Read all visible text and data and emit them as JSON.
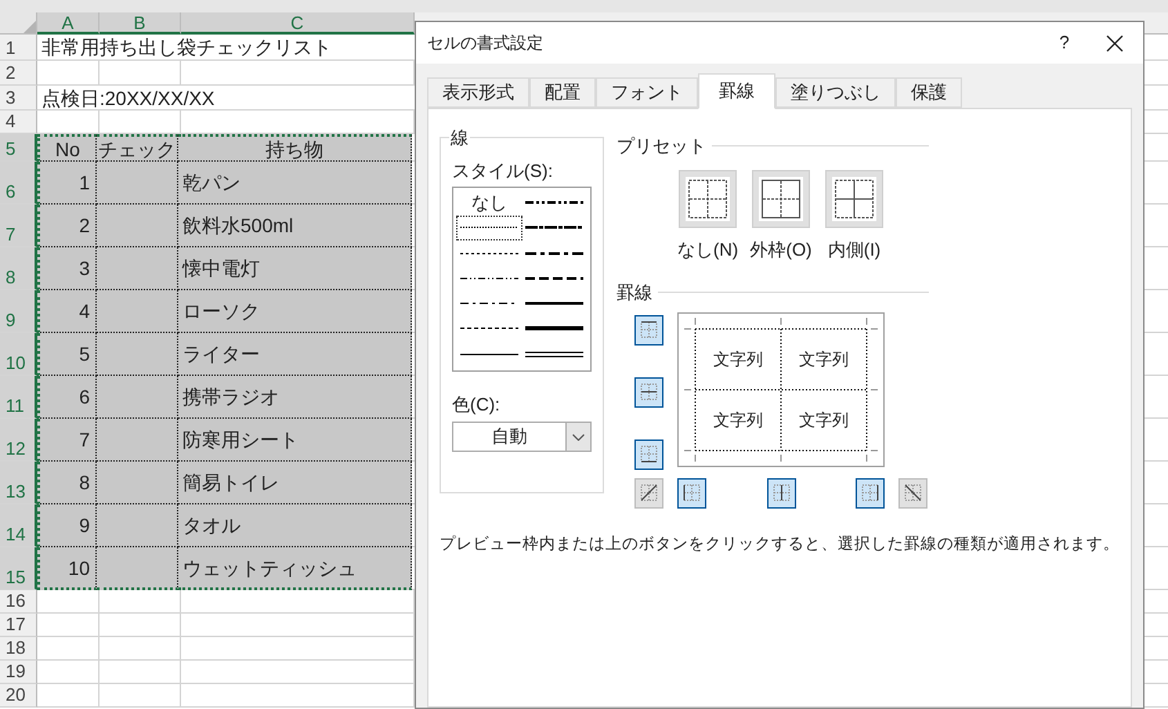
{
  "sheet": {
    "columns": [
      {
        "label": "A",
        "selected": true
      },
      {
        "label": "B",
        "selected": true
      },
      {
        "label": "C",
        "selected": true
      }
    ],
    "rows": [
      {
        "header": "1",
        "kind": "text",
        "text": "非常用持ち出し袋チェックリスト",
        "selected": false
      },
      {
        "header": "2",
        "kind": "blank",
        "selected": false
      },
      {
        "header": "3",
        "kind": "text",
        "text": "点検日:20XX/XX/XX",
        "selected": false
      },
      {
        "header": "4",
        "kind": "blank",
        "selected": false
      },
      {
        "header": "5",
        "kind": "table_header",
        "columns": [
          "No",
          "チェック",
          "持ち物"
        ],
        "selected": true
      },
      {
        "header": "6",
        "kind": "item",
        "no": "1",
        "item": "乾パン",
        "selected": true
      },
      {
        "header": "7",
        "kind": "item",
        "no": "2",
        "item": "飲料水500ml",
        "selected": true
      },
      {
        "header": "8",
        "kind": "item",
        "no": "3",
        "item": "懐中電灯",
        "selected": true
      },
      {
        "header": "9",
        "kind": "item",
        "no": "4",
        "item": "ローソク",
        "selected": true
      },
      {
        "header": "10",
        "kind": "item",
        "no": "5",
        "item": "ライター",
        "selected": true
      },
      {
        "header": "11",
        "kind": "item",
        "no": "6",
        "item": "携帯ラジオ",
        "selected": true
      },
      {
        "header": "12",
        "kind": "item",
        "no": "7",
        "item": "防寒用シート",
        "selected": true
      },
      {
        "header": "13",
        "kind": "item",
        "no": "8",
        "item": "簡易トイレ",
        "selected": true
      },
      {
        "header": "14",
        "kind": "item",
        "no": "9",
        "item": "タオル",
        "selected": true
      },
      {
        "header": "15",
        "kind": "item",
        "no": "10",
        "item": "ウェットティッシュ",
        "selected": true
      },
      {
        "header": "16",
        "kind": "blank",
        "selected": false
      },
      {
        "header": "17",
        "kind": "blank",
        "selected": false
      },
      {
        "header": "18",
        "kind": "blank",
        "selected": false
      },
      {
        "header": "19",
        "kind": "blank",
        "selected": false
      },
      {
        "header": "20",
        "kind": "blank",
        "selected": false
      }
    ]
  },
  "dialog": {
    "title": "セルの書式設定",
    "help": "?",
    "tabs": [
      {
        "label": "表示形式",
        "selected": false
      },
      {
        "label": "配置",
        "selected": false
      },
      {
        "label": "フォント",
        "selected": false
      },
      {
        "label": "罫線",
        "selected": true
      },
      {
        "label": "塗りつぶし",
        "selected": false
      },
      {
        "label": "保護",
        "selected": false
      }
    ],
    "line": {
      "title": "線",
      "style_label": "スタイル(S):",
      "styles": [
        {
          "kind": "none",
          "label": "なし",
          "selected": false
        },
        {
          "kind": "hair",
          "selected": true
        },
        {
          "kind": "dotted",
          "selected": false
        },
        {
          "kind": "dash_dot_dot",
          "selected": false
        },
        {
          "kind": "dash_dot",
          "selected": false
        },
        {
          "kind": "dashed",
          "selected": false
        },
        {
          "kind": "thin",
          "selected": false
        },
        {
          "kind": "medium_dash_dot_dot",
          "selected": false
        },
        {
          "kind": "slant_dash_dot",
          "selected": false
        },
        {
          "kind": "medium_dash_dot",
          "selected": false
        },
        {
          "kind": "medium_dashed",
          "selected": false
        },
        {
          "kind": "medium",
          "selected": false
        },
        {
          "kind": "thick",
          "selected": false
        },
        {
          "kind": "double",
          "selected": false
        }
      ],
      "color_label": "色(C):",
      "color_value": "自動"
    },
    "presets": {
      "title": "プリセット",
      "items": [
        {
          "kind": "none",
          "label": "なし(N)"
        },
        {
          "kind": "outline",
          "label": "外枠(O)"
        },
        {
          "kind": "inside",
          "label": "内側(I)"
        }
      ]
    },
    "border": {
      "title": "罫線",
      "buttons": [
        {
          "kind": "top",
          "pressed": true
        },
        {
          "kind": "inside_horizontal",
          "pressed": true
        },
        {
          "kind": "bottom",
          "pressed": true
        },
        {
          "kind": "diagonal_up",
          "pressed": false
        },
        {
          "kind": "left",
          "pressed": true
        },
        {
          "kind": "inside_vertical",
          "pressed": true
        },
        {
          "kind": "right",
          "pressed": true
        },
        {
          "kind": "diagonal_down",
          "pressed": false
        }
      ],
      "preview_texts": [
        "文字列",
        "文字列",
        "文字列",
        "文字列"
      ]
    },
    "description": "プレビュー枠内または上のボタンをクリックすると、選択した罫線の種類が適用されます。"
  }
}
